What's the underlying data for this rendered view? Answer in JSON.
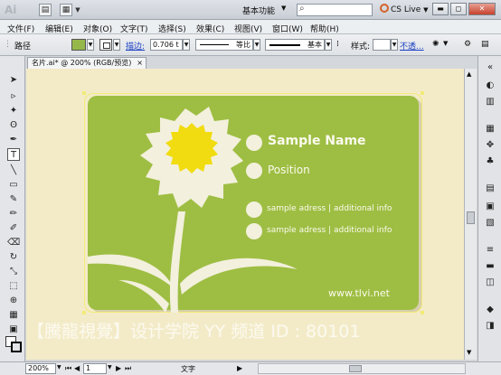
{
  "app": {
    "logo": "Ai",
    "workspace": "基本功能",
    "search_placeholder": "",
    "cs_live": "CS Live"
  },
  "menu": [
    "文件(F)",
    "编辑(E)",
    "对象(O)",
    "文字(T)",
    "选择(S)",
    "效果(C)",
    "视图(V)",
    "窗口(W)",
    "帮助(H)"
  ],
  "control": {
    "selection_label": "路径",
    "stroke_link": "描边:",
    "stroke_weight": "0.706 t",
    "profile_label": "等比",
    "brush_label": "基本",
    "style_label": "样式:",
    "opacity_link": "不透..."
  },
  "document": {
    "tab_title": "名片.ai* @ 200% (RGB/预览)",
    "close_glyph": "×"
  },
  "card": {
    "name": "Sample Name",
    "position": "Position",
    "address1": "sample adress | additional info",
    "address2": "sample adress | additional info",
    "website": "www.tlvi.net"
  },
  "watermark": "【騰龍視覺】设计学院 YY 频道 ID : 80101",
  "status": {
    "zoom": "200%",
    "page": "1",
    "tool_name": "文字"
  },
  "colors": {
    "card_green": "#9ebe43",
    "sunflower_yellow": "#f0dc10",
    "petal_cream": "#f3f0dd",
    "artboard_bg": "#f3ebc8"
  }
}
